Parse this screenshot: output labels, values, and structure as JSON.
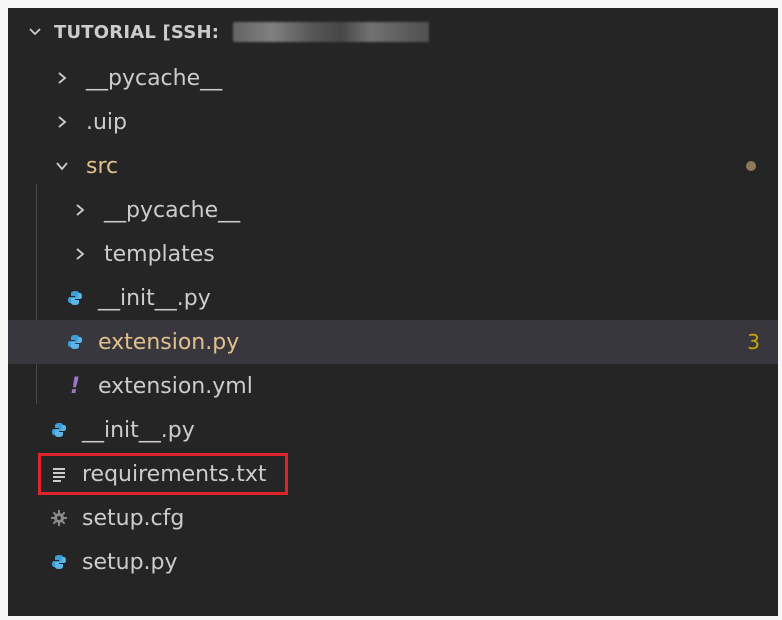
{
  "explorer": {
    "title": "TUTORIAL [SSH:",
    "items": [
      {
        "label": "__pycache__",
        "type": "folder",
        "expanded": false,
        "level": 1
      },
      {
        "label": ".uip",
        "type": "folder",
        "expanded": false,
        "level": 1
      },
      {
        "label": "src",
        "type": "folder",
        "expanded": true,
        "level": 1,
        "modified": true
      },
      {
        "label": "__pycache__",
        "type": "folder",
        "expanded": false,
        "level": 2
      },
      {
        "label": "templates",
        "type": "folder",
        "expanded": false,
        "level": 2
      },
      {
        "label": "__init__.py",
        "type": "python",
        "level": 2
      },
      {
        "label": "extension.py",
        "type": "python",
        "level": 2,
        "modified": true,
        "selected": true,
        "problems": "3"
      },
      {
        "label": "extension.yml",
        "type": "yaml",
        "level": 2
      },
      {
        "label": "__init__.py",
        "type": "python",
        "level": 1
      },
      {
        "label": "requirements.txt",
        "type": "text",
        "level": 1,
        "highlighted": true
      },
      {
        "label": "setup.cfg",
        "type": "config",
        "level": 1
      },
      {
        "label": "setup.py",
        "type": "python",
        "level": 1
      }
    ]
  },
  "colors": {
    "background": "#252526",
    "selected": "#37373d",
    "modified": "#e2c08d",
    "python_icon": "#3b9fd8",
    "yaml_icon": "#a074c4",
    "highlight_box": "#e0242b"
  },
  "icons": {
    "collapsed": "chevron-right-icon",
    "expanded": "chevron-down-icon",
    "python": "python-icon",
    "yaml": "yaml-icon",
    "text": "text-file-icon",
    "config": "gear-icon"
  }
}
